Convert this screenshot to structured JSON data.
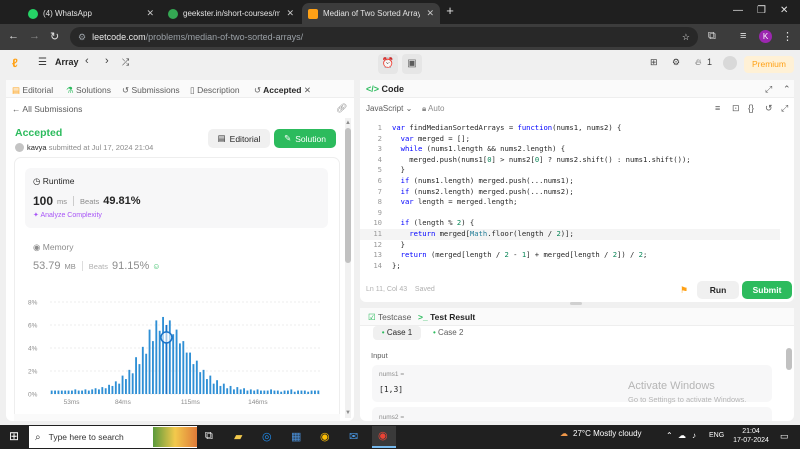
{
  "browser": {
    "tabs": [
      {
        "title": "(4) WhatsApp",
        "color": "#25d366"
      },
      {
        "title": "geekster.in/short-courses/mast",
        "color": "#34a853"
      },
      {
        "title": "Median of Two Sorted Arrays -",
        "color": "#ffa116"
      }
    ],
    "url_domain": "leetcode.com",
    "url_path": "/problems/median-of-two-sorted-arrays/",
    "avatar": "K"
  },
  "lc": {
    "list_label": "Array",
    "streak": "1",
    "premium": "Premium",
    "left_tabs": [
      "Editorial",
      "Solutions",
      "Submissions",
      "Description",
      "Accepted"
    ],
    "all_submissions": "All Submissions",
    "status": "Accepted",
    "user": "kavya",
    "submitted": "submitted at Jul 17, 2024 21:04",
    "editorial_btn": "Editorial",
    "solution_btn": "Solution",
    "runtime": {
      "label": "Runtime",
      "value": "100",
      "unit": "ms",
      "beats_label": "Beats",
      "beats": "49.81%",
      "analyze": "Analyze Complexity"
    },
    "memory": {
      "label": "Memory",
      "value": "53.79",
      "unit": "MB",
      "beats_label": "Beats",
      "beats": "91.15%"
    },
    "code_title": "Code",
    "language": "JavaScript",
    "autosave": "Auto",
    "cursor_pos": "Ln 11, Col 43",
    "saved": "Saved",
    "run": "Run",
    "submit": "Submit",
    "testcase_tab": "Testcase",
    "result_tab": "Test Result",
    "case1": "Case 1",
    "case2": "Case 2",
    "input_label": "Input",
    "nums1_label": "nums1 =",
    "nums1_value": "[1,3]",
    "nums2_label": "nums2 ="
  },
  "code": [
    "var findMedianSortedArrays = function(nums1, nums2) {",
    "  var merged = [];",
    "  while (nums1.length && nums2.length) {",
    "    merged.push(nums1[0] > nums2[0] ? nums2.shift() : nums1.shift());",
    "  }",
    "  if (nums1.length) merged.push(...nums1);",
    "  if (nums2.length) merged.push(...nums2);",
    "  var length = merged.length;",
    "",
    "  if (length % 2) {",
    "    return merged[Math.floor(length / 2)];",
    "  }",
    "  return (merged[length / 2 - 1] + merged[length / 2]) / 2;",
    "};"
  ],
  "chart_data": {
    "type": "bar",
    "y_ticks": [
      "8%",
      "6%",
      "4%",
      "2%",
      "0%"
    ],
    "x_ticks": [
      "53ms",
      "84ms",
      "115ms",
      "146ms"
    ],
    "ylim": [
      0,
      8
    ],
    "values": [
      0.3,
      0.3,
      0.3,
      0.3,
      0.3,
      0.3,
      0.3,
      0.4,
      0.3,
      0.3,
      0.4,
      0.3,
      0.4,
      0.5,
      0.4,
      0.6,
      0.5,
      0.8,
      0.7,
      1.1,
      0.9,
      1.6,
      1.3,
      2.1,
      1.8,
      3.2,
      2.6,
      4.1,
      3.5,
      5.6,
      4.6,
      6.4,
      5.5,
      6.7,
      6.0,
      6.4,
      5.2,
      5.6,
      4.4,
      4.6,
      3.6,
      3.6,
      2.6,
      2.9,
      1.9,
      2.1,
      1.3,
      1.6,
      0.9,
      1.2,
      0.7,
      0.9,
      0.5,
      0.7,
      0.4,
      0.6,
      0.4,
      0.5,
      0.3,
      0.4,
      0.3,
      0.4,
      0.3,
      0.3,
      0.3,
      0.4,
      0.3,
      0.3,
      0.2,
      0.3,
      0.3,
      0.4,
      0.2,
      0.3,
      0.3,
      0.3,
      0.2,
      0.3,
      0.3,
      0.3
    ],
    "highlight_index": 34
  },
  "taskbar": {
    "search_placeholder": "Type here to search",
    "weather": "27°C  Mostly cloudy",
    "lang": "ENG",
    "time": "21:04",
    "date": "17-07-2024"
  },
  "watermark": {
    "line1": "Activate Windows",
    "line2": "Go to Settings to activate Windows."
  }
}
